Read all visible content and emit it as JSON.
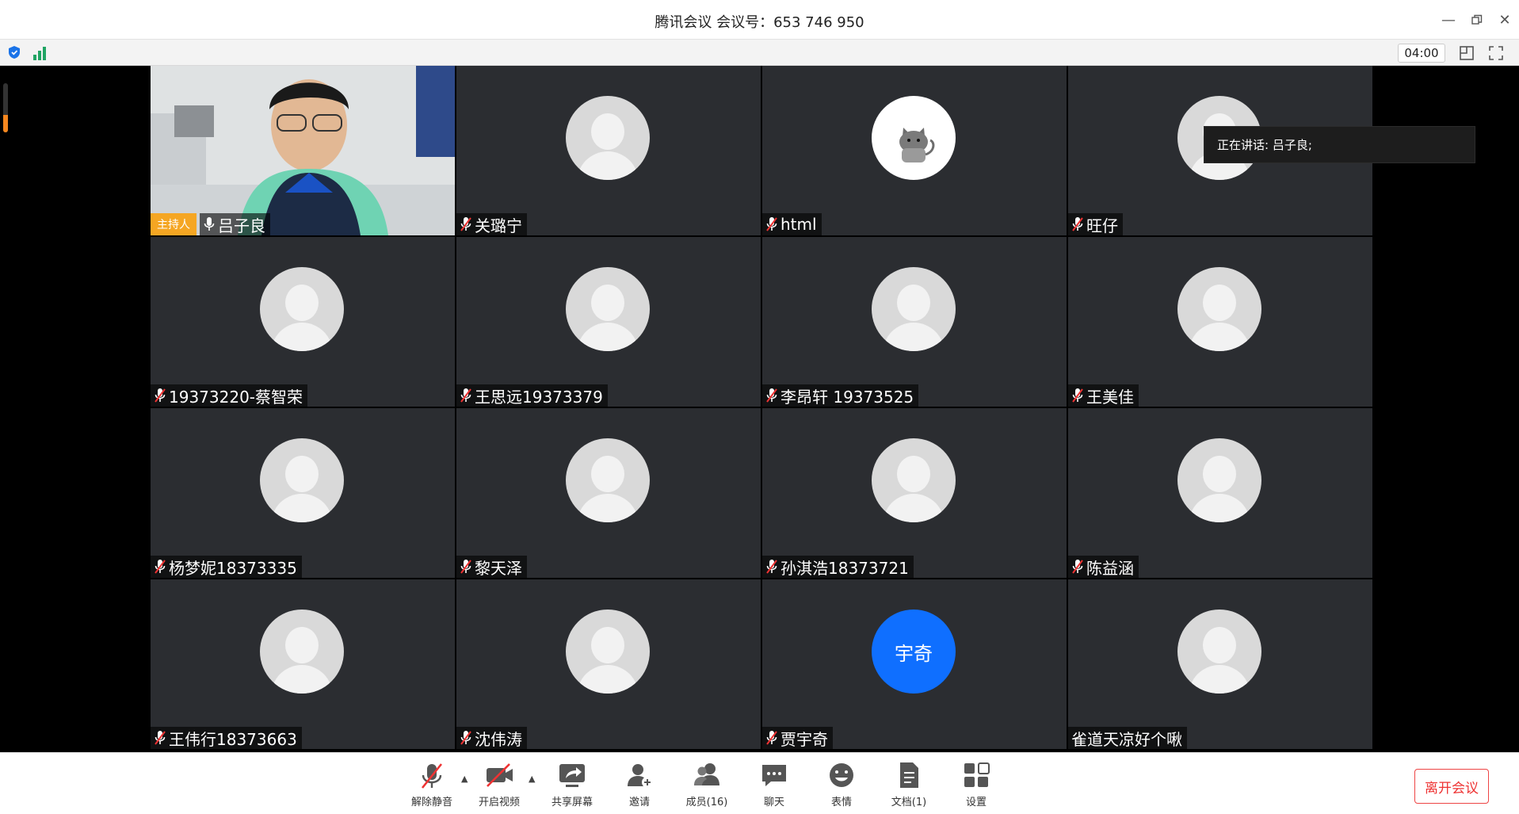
{
  "window": {
    "title": "腾讯会议 会议号：653 746 950"
  },
  "toolbar": {
    "timer": "04:00",
    "icons": [
      "security-shield-icon",
      "signal-strength-icon",
      "layout-icon",
      "fullscreen-icon"
    ]
  },
  "speaking_banner": "正在讲话: 吕子良;",
  "host_badge": "主持人",
  "mic_level": 0.35,
  "participants": [
    {
      "name": "吕子良",
      "video": true,
      "muted": false,
      "host": true
    },
    {
      "name": "关璐宁",
      "muted": true
    },
    {
      "name": "html",
      "muted": true,
      "avatar": "cat"
    },
    {
      "name": "旺仔",
      "muted": true
    },
    {
      "name": "19373220-蔡智荣",
      "muted": true
    },
    {
      "name": "王思远19373379",
      "muted": true
    },
    {
      "name": "李昂轩 19373525",
      "muted": true
    },
    {
      "name": "王美佳",
      "muted": true
    },
    {
      "name": "杨梦妮18373335",
      "muted": true
    },
    {
      "name": "黎天泽",
      "muted": true
    },
    {
      "name": "孙淇浩18373721",
      "muted": true
    },
    {
      "name": "陈益涵",
      "muted": true
    },
    {
      "name": "王伟行18373663",
      "muted": true
    },
    {
      "name": "沈伟涛",
      "muted": true
    },
    {
      "name": "贾宇奇",
      "muted": true,
      "avatar_text": "宇奇"
    },
    {
      "name": "雀道天凉好个啾",
      "muted": false,
      "no_mic": true
    }
  ],
  "bottom_bar": {
    "unmute": "解除静音",
    "video": "开启视频",
    "share": "共享屏幕",
    "invite": "邀请",
    "members": "成员(16)",
    "chat": "聊天",
    "reaction": "表情",
    "docs": "文档(1)",
    "settings": "设置",
    "leave": "离开会议"
  },
  "colors": {
    "tile_bg": "#2b2d31",
    "host_badge": "#f5a623",
    "leave": "#e33333",
    "accent_blue": "#0f6fff"
  }
}
